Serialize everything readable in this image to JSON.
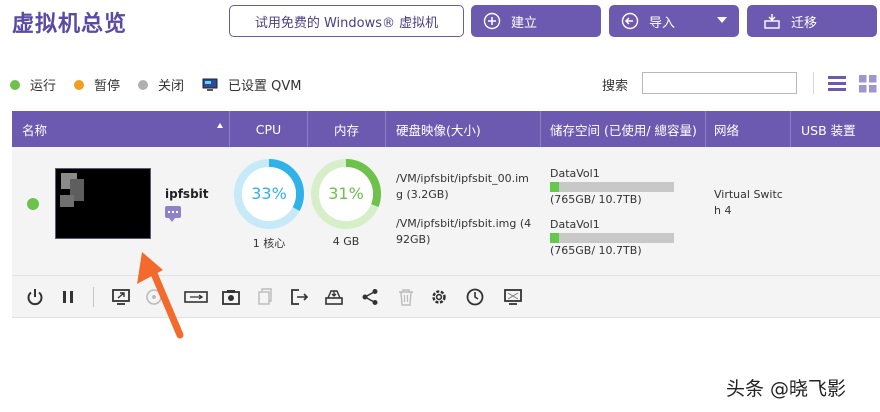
{
  "header": {
    "title": "虚拟机总览",
    "trial_button": "试用免费的 Windows® 虚拟机",
    "create_button": "建立",
    "import_button": "导入",
    "migrate_button": "迁移"
  },
  "legend": {
    "running": "运行",
    "paused": "暂停",
    "off": "关闭",
    "qvm": "已设置 QVM",
    "colors": {
      "running": "#6cc24a",
      "paused": "#f0a020",
      "off": "#b0b0b0"
    }
  },
  "search": {
    "label": "搜索",
    "value": "",
    "placeholder": ""
  },
  "table": {
    "columns": {
      "name": "名称",
      "cpu": "CPU",
      "memory": "内存",
      "disk": "硬盘映像(大小)",
      "storage": "储存空间 (已使用/ 總容量)",
      "network": "网络",
      "usb": "USB 装置"
    },
    "rows": [
      {
        "status": "running",
        "name": "ipfsbit",
        "cpu_percent": 33,
        "cpu_label": "33%",
        "cpu_cores": "1 核心",
        "mem_percent": 31,
        "mem_label": "31%",
        "mem_size": "4 GB",
        "disks": [
          {
            "path": "/VM/ipfsbit/ipfsbit_00.img (3.2GB)"
          },
          {
            "path": "/VM/ipfsbit/ipfsbit.img (492GB)"
          }
        ],
        "storage": [
          {
            "volume": "DataVol1",
            "usage": "(765GB/ 10.7TB)",
            "fill": 0.07
          },
          {
            "volume": "DataVol1",
            "usage": "(765GB/ 10.7TB)",
            "fill": 0.07
          }
        ],
        "network": "Virtual Switch 4",
        "usb": ""
      }
    ]
  },
  "toolbar": [
    "power-icon",
    "pause-icon",
    "console-icon",
    "disc-icon",
    "usb-icon",
    "snapshot-icon",
    "clone-icon",
    "export-icon",
    "drive-icon",
    "share-icon",
    "delete-icon",
    "settings-icon",
    "history-icon",
    "display-icon"
  ],
  "watermark": "头条 @晓飞影",
  "accent_color": "#6c5ab0"
}
